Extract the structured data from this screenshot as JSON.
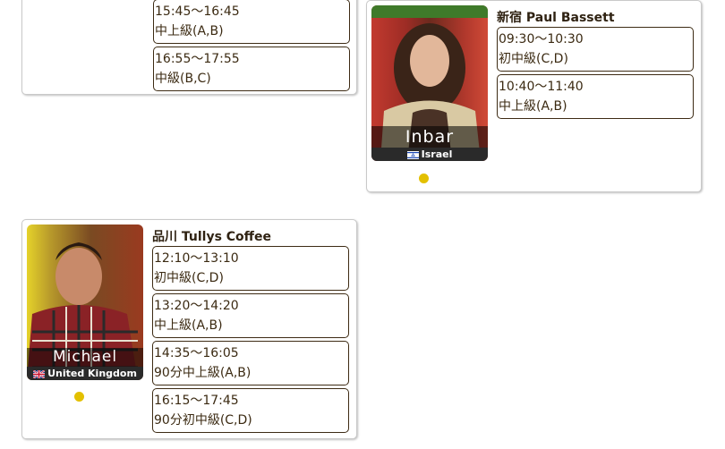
{
  "cards": [
    {
      "place": "",
      "teacher": "",
      "country": "",
      "slots": [
        {
          "time": "15:45～16:45",
          "level": "中上級(A,B)"
        },
        {
          "time": "16:55～17:55",
          "level": "中級(B,C)"
        }
      ]
    },
    {
      "place": "新宿 Paul Bassett",
      "teacher": "Inbar",
      "country": "Israel",
      "slots": [
        {
          "time": "09:30～10:30",
          "level": "初中級(C,D)"
        },
        {
          "time": "10:40～11:40",
          "level": "中上級(A,B)"
        }
      ]
    },
    {
      "place": "品川 Tullys Coffee",
      "teacher": "Michael",
      "country": "United Kingdom",
      "slots": [
        {
          "time": "12:10～13:10",
          "level": "初中級(C,D)"
        },
        {
          "time": "13:20～14:20",
          "level": "中上級(A,B)"
        },
        {
          "time": "14:35～16:05",
          "level": "90分中上級(A,B)"
        },
        {
          "time": "16:15～17:45",
          "level": "90分初中級(C,D)"
        }
      ]
    }
  ],
  "colors": {
    "status_dot": "#e3c000",
    "slot_border": "#3d2b14",
    "text": "#3b2a12"
  },
  "icons": {
    "israel": "israel-flag-icon",
    "uk": "uk-flag-icon"
  }
}
